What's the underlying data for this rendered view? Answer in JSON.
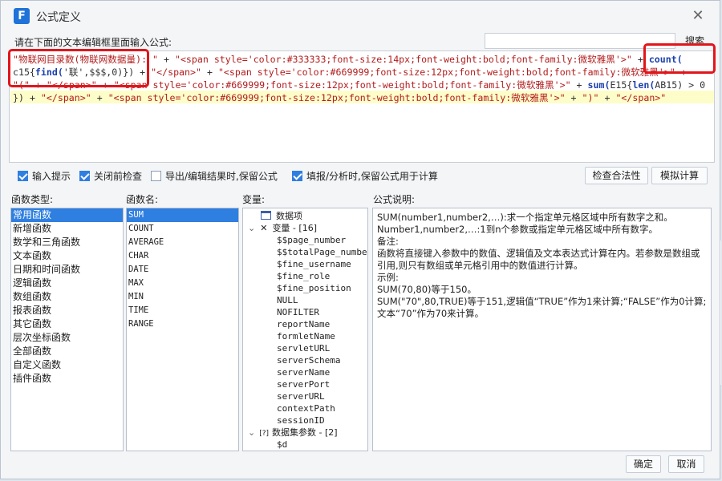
{
  "window": {
    "title": "公式定义",
    "logo_letter": "F"
  },
  "toolbar": {
    "hint": "请在下面的文本编辑框里面输入公式:",
    "search_placeholder": "",
    "search_label": "搜索"
  },
  "editor": {
    "line1": [
      {
        "t": "\"物联网目录数(物联网数据量): \"",
        "c": "str"
      },
      {
        "t": " + ",
        "c": "op"
      },
      {
        "t": "\"<span style='color:#333333;font-size:14px;font-weight:bold;font-family:微软雅黑'>\"",
        "c": "str"
      },
      {
        "t": " + ",
        "c": "op"
      },
      {
        "t": "count(",
        "c": "fn"
      }
    ],
    "line2": [
      {
        "t": "c15{",
        "c": "plain"
      },
      {
        "t": "find(",
        "c": "fn"
      },
      {
        "t": "'联',$$$,0)}) + ",
        "c": "plain"
      },
      {
        "t": "\"</span>\"",
        "c": "str"
      },
      {
        "t": " + ",
        "c": "op"
      },
      {
        "t": "\"<span style='color:#669999;font-size:12px;font-weight:bold;font-family:微软雅黑'>\"",
        "c": "str"
      },
      {
        "t": " +",
        "c": "op"
      }
    ],
    "line3": [
      {
        "t": "\"(\"",
        "c": "str"
      },
      {
        "t": " + ",
        "c": "op"
      },
      {
        "t": "\"</span>\"",
        "c": "str"
      },
      {
        "t": " + ",
        "c": "op"
      },
      {
        "t": "\"<span style='color:#669999;font-size:12px;font-weight:bold;font-family:微软雅黑'>\"",
        "c": "str"
      },
      {
        "t": " + ",
        "c": "op"
      },
      {
        "t": "sum(",
        "c": "fn"
      },
      {
        "t": "E15{",
        "c": "plain"
      },
      {
        "t": "len(",
        "c": "fn"
      },
      {
        "t": "AB15) > 0",
        "c": "plain"
      }
    ],
    "line4": [
      {
        "t": "}) + ",
        "c": "plain"
      },
      {
        "t": "\"</span>\"",
        "c": "str"
      },
      {
        "t": " + ",
        "c": "op"
      },
      {
        "t": "\"<span style='color:#669999;font-size:12px;font-weight:bold;font-family:微软雅黑'>\"",
        "c": "str"
      },
      {
        "t": " + ",
        "c": "op"
      },
      {
        "t": "\")\"",
        "c": "str"
      },
      {
        "t": " + ",
        "c": "op"
      },
      {
        "t": "\"</span>\"",
        "c": "str"
      }
    ]
  },
  "options": {
    "input_hint": {
      "label": "输入提示",
      "checked": true
    },
    "check_before_close": {
      "label": "关闭前检查",
      "checked": true
    },
    "keep_formula_export": {
      "label": "导出/编辑结果时,保留公式",
      "checked": false
    },
    "keep_formula_fill": {
      "label": "填报/分析时,保留公式用于计算",
      "checked": true
    },
    "check_validity_label": "检查合法性",
    "simulate_label": "模拟计算"
  },
  "panels": {
    "func_type_label": "函数类型:",
    "func_name_label": "函数名:",
    "variable_label": "变量:",
    "formula_desc_label": "公式说明:"
  },
  "func_types": [
    "常用函数",
    "新增函数",
    "数学和三角函数",
    "文本函数",
    "日期和时间函数",
    "逻辑函数",
    "数组函数",
    "报表函数",
    "其它函数",
    "层次坐标函数",
    "全部函数",
    "自定义函数",
    "插件函数"
  ],
  "func_names": [
    "SUM",
    "COUNT",
    "AVERAGE",
    "CHAR",
    "DATE",
    "MAX",
    "MIN",
    "TIME",
    "RANGE"
  ],
  "variables": {
    "data_item": "数据项",
    "variable_group": "变量 - [16]",
    "items": [
      "$$page_number",
      "$$totalPage_number",
      "$fine_username",
      "$fine_role",
      "$fine_position",
      "NULL",
      "NOFILTER",
      "reportName",
      "formletName",
      "servletURL",
      "serverSchema",
      "serverName",
      "serverPort",
      "serverURL",
      "contextPath",
      "sessionID"
    ],
    "dataset_params": "数据集参数 - [2]",
    "dataset_items": [
      "$d"
    ]
  },
  "description": [
    "SUM(number1,number2,…):求一个指定单元格区域中所有数字之和。",
    "Number1,number2,…:1到n个参数或指定单元格区域中所有数字。",
    "备注:",
    "函数将直接键入参数中的数值、逻辑值及文本表达式计算在内。若参数是数组或引用,则只有数组或单元格引用中的数值进行计算。",
    "示例:",
    "SUM(70,80)等于150。",
    "SUM(\"70\",80,TRUE)等于151,逻辑值“TRUE”作为1来计算;“FALSE”作为0计算;文本“70”作为70来计算。"
  ],
  "footer": {
    "ok_label": "确定",
    "cancel_label": "取消"
  },
  "colors": {
    "accent": "#2f7fe0",
    "annotation": "#e2151b",
    "highlight": "#fdfdc9"
  }
}
